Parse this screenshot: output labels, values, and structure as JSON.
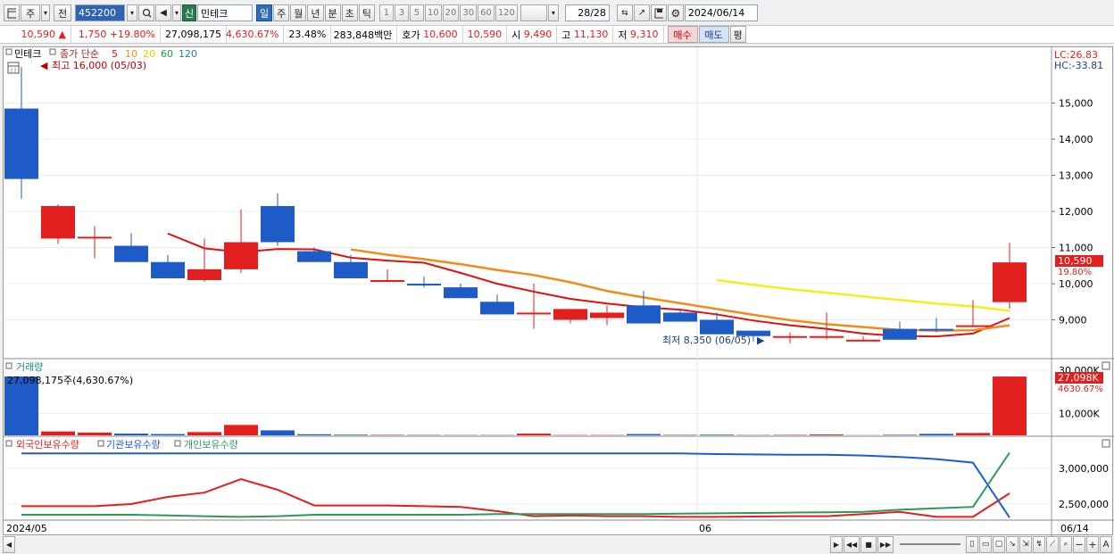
{
  "toolbar": {
    "period_label": "주",
    "prev_label": "전",
    "stock_code": "452200",
    "credit_badge": "신",
    "stock_name": "민테크",
    "period_tabs": [
      "일",
      "주",
      "월",
      "년",
      "분",
      "초",
      "틱"
    ],
    "active_period": "일",
    "interval_buttons": [
      "1",
      "3",
      "5",
      "10",
      "20",
      "30",
      "60",
      "120"
    ],
    "count": "28/28",
    "date": "2024/06/14"
  },
  "quote": {
    "price": "10,590",
    "direction": "▲",
    "change": "1,750",
    "change_pct": "+19.80%",
    "volume": "27,098,175",
    "volume_ratio": "4,630.67%",
    "turnover": "23.48%",
    "amount": "283,848백만",
    "ask_label": "호가",
    "ask": "10,600",
    "bid": "10,590",
    "open_label": "시",
    "open": "9,490",
    "high_label": "고",
    "high": "11,130",
    "low_label": "저",
    "low": "9,310",
    "buy_label": "매수",
    "sell_label": "매도",
    "eval_label": "평"
  },
  "price_panel": {
    "name": "민테크",
    "ma_label": "종가 단순",
    "ma_periods": [
      "5",
      "10",
      "20",
      "60",
      "120"
    ],
    "high_note": "최고 16,000 (05/03)",
    "low_note": "최저 8,350 (06/05)",
    "lc": "LC:26.83",
    "hc": "HC:-33.81",
    "y_ticks": [
      "15,000",
      "14,000",
      "13,000",
      "12,000",
      "11,000",
      "10,000",
      "9,000"
    ],
    "last_price_tag": "10,590",
    "last_pct_tag": "19.80%"
  },
  "volume_panel": {
    "title": "거래량",
    "summary": "27,098,175주(4,630.67%)",
    "y_ticks": [
      "30,000K",
      "10,000K"
    ],
    "last_tag": "27,098K",
    "last_pct": "4630.67%"
  },
  "holdings_panel": {
    "titles": [
      "외국인보유수량",
      "기관보유수량",
      "개인보유수량"
    ],
    "y_ticks": [
      "3,000,000",
      "2,500,000"
    ]
  },
  "x_axis": {
    "start": "2024/05",
    "mid": "06",
    "end": "06/14"
  },
  "colors": {
    "up": "#e21f1f",
    "down": "#1e5bc6",
    "ma5": "#e01010",
    "ma10": "#f08c1c",
    "ma20": "#f0f01e",
    "ma60": "#19a03c",
    "ma120": "#1e78c8",
    "foreign": "#e21f1f",
    "institution": "#1e5bd6",
    "individual": "#2e9a5a"
  },
  "chart_data": {
    "type": "candlestick",
    "dates": [
      "05/03",
      "05/07",
      "05/08",
      "05/09",
      "05/10",
      "05/13",
      "05/14",
      "05/16",
      "05/17",
      "05/20",
      "05/21",
      "05/22",
      "05/23",
      "05/24",
      "05/27",
      "05/28",
      "05/29",
      "05/30",
      "05/31",
      "06/03",
      "06/04",
      "06/05",
      "06/07",
      "06/10",
      "06/11",
      "06/12",
      "06/13",
      "06/14"
    ],
    "open": [
      14850,
      11250,
      11300,
      11050,
      10600,
      10100,
      10400,
      12150,
      10900,
      10600,
      10100,
      10000,
      9900,
      9500,
      9200,
      9000,
      9050,
      9400,
      9200,
      9000,
      8700,
      8550,
      8550,
      8450,
      8750,
      8750,
      8850,
      9490
    ],
    "high": [
      16000,
      12200,
      11600,
      11400,
      10800,
      11250,
      12050,
      12500,
      11000,
      10800,
      10400,
      10200,
      10000,
      9700,
      10000,
      9300,
      9400,
      9800,
      9300,
      9200,
      8700,
      8650,
      9200,
      8550,
      8950,
      9050,
      9550,
      11130
    ],
    "low": [
      12350,
      11100,
      10700,
      10600,
      10150,
      10050,
      10300,
      11050,
      10650,
      10150,
      10050,
      9900,
      9600,
      9150,
      8750,
      8900,
      8850,
      8900,
      8950,
      8700,
      8400,
      8350,
      8450,
      8400,
      8450,
      8650,
      8800,
      9310
    ],
    "close": [
      12900,
      12150,
      11300,
      10600,
      10150,
      10400,
      11150,
      11150,
      10600,
      10150,
      10100,
      9950,
      9600,
      9150,
      9200,
      9300,
      9200,
      8900,
      8950,
      8600,
      8550,
      8550,
      8550,
      8450,
      8450,
      8700,
      8850,
      10590
    ],
    "ma5": [
      null,
      null,
      null,
      null,
      11390,
      10980,
      10870,
      10960,
      10950,
      10720,
      10640,
      10580,
      10300,
      10000,
      9780,
      9580,
      9450,
      9350,
      9280,
      9150,
      8980,
      8850,
      8750,
      8620,
      8550,
      8540,
      8620,
      9050
    ],
    "ma10": [
      null,
      null,
      null,
      null,
      null,
      null,
      null,
      null,
      null,
      10950,
      10800,
      10680,
      10540,
      10380,
      10240,
      10040,
      9800,
      9620,
      9460,
      9300,
      9140,
      8990,
      8880,
      8800,
      8720,
      8700,
      8710,
      8850
    ],
    "ma20": [
      null,
      null,
      null,
      null,
      null,
      null,
      null,
      null,
      null,
      null,
      null,
      null,
      null,
      null,
      null,
      null,
      null,
      null,
      null,
      10100,
      9970,
      9850,
      9750,
      9650,
      9550,
      9450,
      9370,
      9250
    ],
    "volume_k": [
      27098,
      1800,
      1300,
      800,
      600,
      1500,
      4800,
      2300,
      500,
      300,
      200,
      180,
      150,
      150,
      800,
      150,
      150,
      600,
      200,
      300,
      150,
      200,
      400,
      100,
      250,
      700,
      1100,
      27098
    ],
    "foreign": [
      2470000,
      2470000,
      2470000,
      2500000,
      2600000,
      2660000,
      2850000,
      2700000,
      2480000,
      2480000,
      2480000,
      2470000,
      2460000,
      2400000,
      2330000,
      2340000,
      2330000,
      2330000,
      2320000,
      2320000,
      2325000,
      2330000,
      2330000,
      2360000,
      2390000,
      2320000,
      2320000,
      2650000
    ],
    "institution": [
      3210000,
      3210000,
      3210000,
      3210000,
      3210000,
      3210000,
      3210000,
      3210000,
      3210000,
      3210000,
      3210000,
      3210000,
      3210000,
      3210000,
      3210000,
      3210000,
      3210000,
      3210000,
      3210000,
      3200000,
      3195000,
      3190000,
      3190000,
      3180000,
      3160000,
      3130000,
      3080000,
      2310000
    ],
    "individual": [
      2350000,
      2350000,
      2350000,
      2350000,
      2340000,
      2330000,
      2320000,
      2330000,
      2350000,
      2350000,
      2350000,
      2350000,
      2350000,
      2360000,
      2360000,
      2360000,
      2360000,
      2360000,
      2365000,
      2370000,
      2375000,
      2380000,
      2385000,
      2390000,
      2420000,
      2440000,
      2460000,
      3220000
    ],
    "price_ylim": [
      8000,
      16200
    ],
    "volume_ylim": [
      0,
      30000
    ],
    "holdings_ylim": [
      2300000,
      3300000
    ]
  }
}
